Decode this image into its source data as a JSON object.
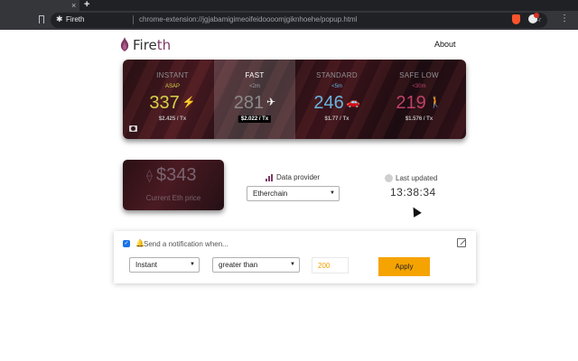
{
  "browser": {
    "tab_title": "Fireth",
    "tab_close": "×",
    "new_tab": "+",
    "site_name": "Fireth",
    "url": "chrome-extension://jgjabamigimeoifeidoooomjgiknhoehe/popup.html",
    "star": "☆",
    "menu": "⋮"
  },
  "header": {
    "brand_main": "Fire",
    "brand_accent": "th",
    "about": "About"
  },
  "gas_speeds": [
    {
      "name": "INSTANT",
      "time": "ASAP",
      "value": "337",
      "glyph": "⚡",
      "price": "$2.425 / Tx",
      "color": "#d4d14a",
      "time_color": "#d4d14a",
      "selected": false
    },
    {
      "name": "FAST",
      "time": "<2m",
      "value": "281",
      "glyph": "✈",
      "price": "$2.022 / Tx",
      "color": "#8a8a8a",
      "time_color": "#9aa0a6",
      "selected": true
    },
    {
      "name": "STANDARD",
      "time": "<5m",
      "value": "246",
      "glyph": "🚗",
      "price": "$1.77 / Tx",
      "color": "#6ab4e0",
      "time_color": "#6ab4e0",
      "selected": false
    },
    {
      "name": "SAFE LOW",
      "time": "<30m",
      "value": "219",
      "glyph": "🚶",
      "price": "$1.576 / Tx",
      "color": "#c0406a",
      "time_color": "#c0406a",
      "selected": false
    }
  ],
  "eth_price": {
    "symbol": "⟠",
    "amount": "$343",
    "label": "Current Eth price"
  },
  "provider": {
    "label": "Data provider",
    "selected": "Etherchain"
  },
  "last_updated": {
    "label": "Last updated",
    "time": "13:38:34"
  },
  "notification": {
    "enabled": true,
    "title": "Send a notification when...",
    "bell": "🔔",
    "speed_selected": "Instant",
    "comparison_selected": "greater than",
    "threshold": "200",
    "apply_label": "Apply"
  }
}
